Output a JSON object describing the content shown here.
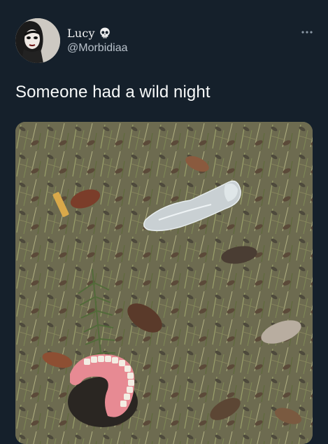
{
  "tweet": {
    "display_name": "Lucy",
    "name_emoji_icon": "skull-icon",
    "handle": "@Morbidiaa",
    "more_icon": "more-horizontal-icon",
    "text": "Someone had a wild night",
    "media_icon": "photo-image"
  },
  "colors": {
    "background": "#15202b",
    "text_primary": "#f7f9f9",
    "text_secondary": "#b9c2cb"
  }
}
